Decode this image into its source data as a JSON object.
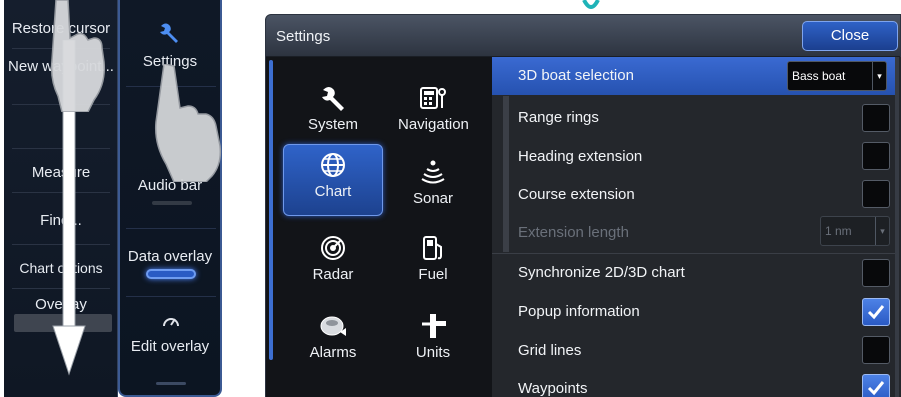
{
  "left_menu": {
    "items": [
      "Restore cursor",
      "New waypoint...",
      "Measure",
      "Find...",
      "Chart options",
      "Overlay"
    ]
  },
  "tools_menu": {
    "items": [
      "Settings",
      "Audio bar",
      "Data overlay",
      "Edit overlay"
    ],
    "icons": [
      "wrench-icon",
      "gauge-icon"
    ]
  },
  "dialog": {
    "title": "Settings",
    "close_label": "Close",
    "categories": [
      {
        "label": "System",
        "icon": "wrench-icon"
      },
      {
        "label": "Navigation",
        "icon": "navigation-icon"
      },
      {
        "label": "Chart",
        "icon": "globe-icon",
        "selected": true
      },
      {
        "label": "Sonar",
        "icon": "sonar-icon"
      },
      {
        "label": "Radar",
        "icon": "radar-icon"
      },
      {
        "label": "Fuel",
        "icon": "fuel-pump-icon"
      },
      {
        "label": "Alarms",
        "icon": "alarm-icon"
      },
      {
        "label": "Units",
        "icon": "ruler-icon"
      }
    ],
    "options": [
      {
        "label": "3D boat selection",
        "control": "dropdown",
        "value": "Bass boat",
        "selected": true
      },
      {
        "label": "Range rings",
        "control": "checkbox",
        "checked": false
      },
      {
        "label": "Heading extension",
        "control": "checkbox",
        "checked": false
      },
      {
        "label": "Course extension",
        "control": "checkbox",
        "checked": false
      },
      {
        "label": "Extension length",
        "control": "dropdown",
        "value": "1 nm",
        "disabled": true
      },
      {
        "label": "Synchronize 2D/3D chart",
        "control": "checkbox",
        "checked": false
      },
      {
        "label": "Popup information",
        "control": "checkbox",
        "checked": true
      },
      {
        "label": "Grid lines",
        "control": "checkbox",
        "checked": false
      },
      {
        "label": "Waypoints",
        "control": "checkbox",
        "checked": true
      }
    ]
  },
  "colors": {
    "accent": "#2f63c9",
    "menu_bg": "#151e2d",
    "dialog_bg": "#24272c",
    "hint_mark": "#1fb3b8"
  }
}
